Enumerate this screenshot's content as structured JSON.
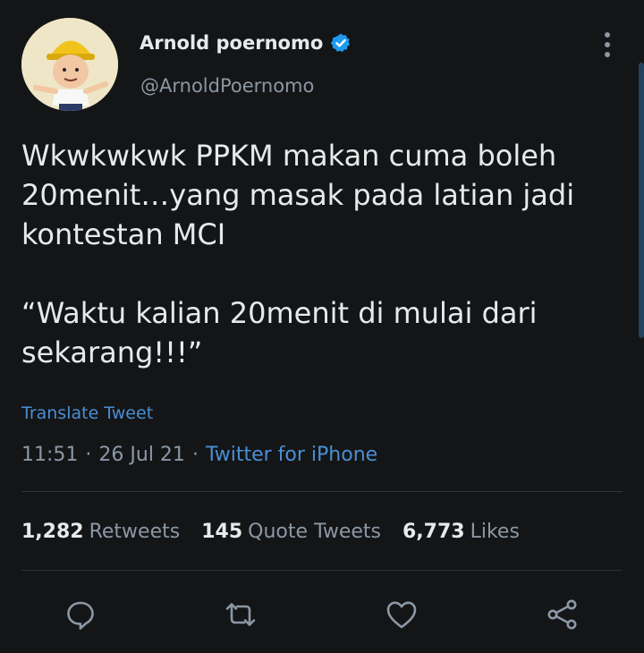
{
  "author": {
    "name": "Arnold poernomo",
    "handle": "@ArnoldPoernomo",
    "verified": true
  },
  "tweet": {
    "paragraphs": [
      "Wkwkwkwk PPKM makan cuma boleh 20menit…yang masak pada latian jadi kontestan MCI",
      "“Waktu kalian 20menit di mulai dari sekarang!!!”"
    ],
    "translate_label": "Translate Tweet",
    "time": "11:51",
    "date": "26 Jul 21",
    "source": "Twitter for iPhone",
    "separator": "·"
  },
  "stats": {
    "retweets": {
      "count": "1,282",
      "label": "Retweets"
    },
    "quotes": {
      "count": "145",
      "label": "Quote Tweets"
    },
    "likes": {
      "count": "6,773",
      "label": "Likes"
    }
  },
  "actions": [
    "reply-icon",
    "retweet-icon",
    "like-icon",
    "share-icon"
  ],
  "colors": {
    "background": "#141517",
    "text": "#e7e9ea",
    "secondary": "#8b98a5",
    "link": "#4a8fd4",
    "verified": "#1d9bf0"
  }
}
